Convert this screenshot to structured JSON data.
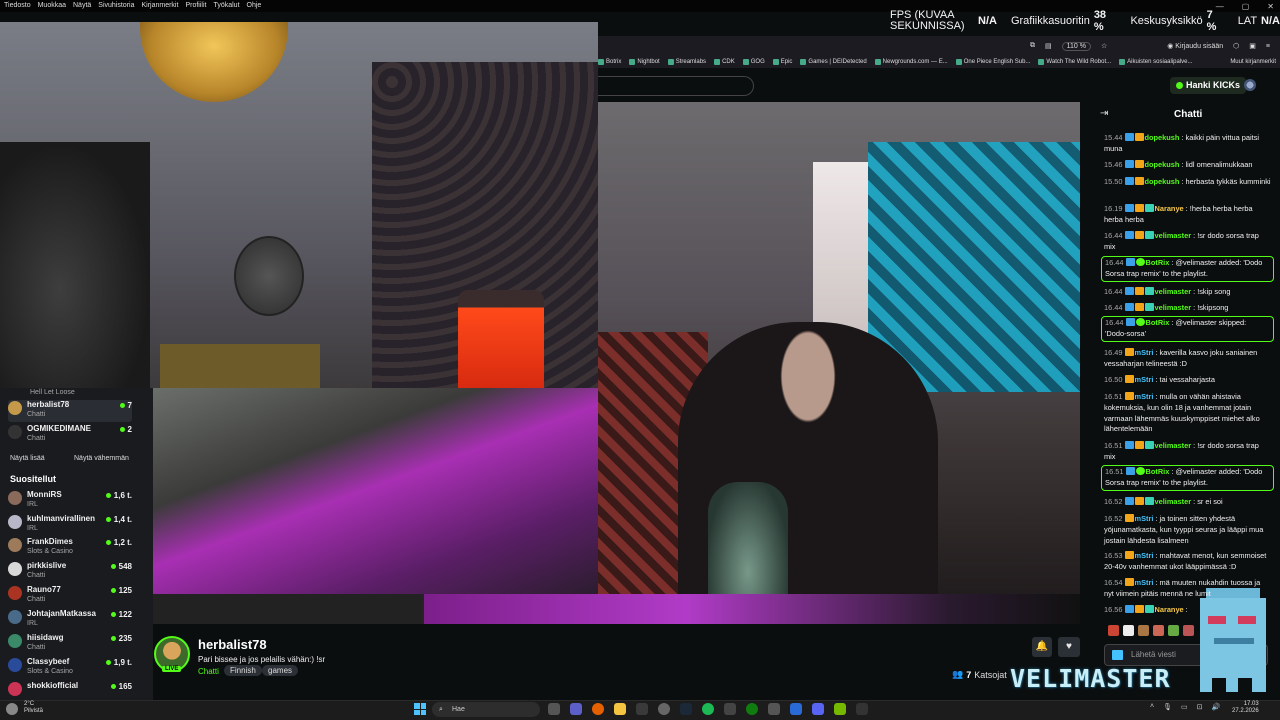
{
  "browser_menu": [
    "Tiedosto",
    "Muokkaa",
    "Näytä",
    "Sivuhistoria",
    "Kirjanmerkit",
    "Profiilit",
    "Työkalut",
    "Ohje"
  ],
  "perf_overlay": {
    "fps_label": "FPS (KUVAA SEKUNNISSA)",
    "fps_value": "N/A",
    "gpu_label": "Grafiikkasuoritin",
    "gpu_value": "38 %",
    "cpu_label": "Keskusyksikkö",
    "cpu_value": "7 %",
    "lat_label": "LAT",
    "lat_value": "N/A"
  },
  "navbar": {
    "zoom": "110 %",
    "signin": "Kirjaudu sisään"
  },
  "bookmarks": [
    "Botrix",
    "Nightbot",
    "Streamlabs",
    "CDK",
    "GOG",
    "Epic",
    "Games | DEIDetected",
    "Newgrounds.com — E...",
    "One Piece English Sub...",
    "Watch The Wild Robot...",
    "Aikuisten sosiaalipalve..."
  ],
  "bookmarks_other": "Muut kirjanmerkit",
  "header": {
    "get_kicks": "Hanki KICKs"
  },
  "sidebar": {
    "prev_label": "Hell Let Loose",
    "following": [
      {
        "name": "herbalist78",
        "sub": "Chatti",
        "count": "7",
        "avatar_color": "#c49a4a"
      },
      {
        "name": "OGMIKEDIMANE",
        "sub": "Chatti",
        "count": "2",
        "avatar_color": "#333333"
      }
    ],
    "show_more": "Näytä lisää",
    "show_less": "Näytä vähemmän",
    "recommended_title": "Suositellut",
    "recommended": [
      {
        "name": "MonniRS",
        "sub": "IRL",
        "count": "1,6 t.",
        "avatar_color": "#8a6a5a"
      },
      {
        "name": "kuhlmanvirallinen",
        "sub": "IRL",
        "count": "1,4 t.",
        "avatar_color": "#b7b7c7"
      },
      {
        "name": "FrankDimes",
        "sub": "Slots & Casino",
        "count": "1,2 t.",
        "avatar_color": "#9c7a5a"
      },
      {
        "name": "pirkkislive",
        "sub": "Chatti",
        "count": "548",
        "avatar_color": "#d8d8d8"
      },
      {
        "name": "Rauno77",
        "sub": "Chatti",
        "count": "125",
        "avatar_color": "#aa3322"
      },
      {
        "name": "JohtajanMatkassa",
        "sub": "IRL",
        "count": "122",
        "avatar_color": "#4a6a8a"
      },
      {
        "name": "hiisidawg",
        "sub": "Chatti",
        "count": "235",
        "avatar_color": "#3a8a6a"
      },
      {
        "name": "Classybeef",
        "sub": "Slots & Casino",
        "count": "1,9 t.",
        "avatar_color": "#2a4a9a"
      },
      {
        "name": "shokkiofficial",
        "sub": "",
        "count": "165",
        "avatar_color": "#cc3355"
      }
    ]
  },
  "channel": {
    "name": "herbalist78",
    "live": "LIVE",
    "title": "Pari bissee ja jos pelailis vähän:) !sr",
    "category": "Chatti",
    "tags": [
      "Finnish",
      "games"
    ],
    "viewers_count": "7",
    "viewers_label": "Katsojat",
    "brand": "VELIMASTER"
  },
  "chat": {
    "title": "Chatti",
    "input_placeholder": "Lähetä viesti",
    "messages": [
      {
        "ts": "15.44",
        "user": "dopekush",
        "color": "u-green",
        "text": "kaikki päin vittua paitsi muna",
        "badges": [
          "b1",
          "b2"
        ],
        "bot": false
      },
      {
        "ts": "15.46",
        "user": "dopekush",
        "color": "u-green",
        "text": "lidl omenalimukkaan",
        "badges": [
          "b1",
          "b2"
        ],
        "bot": false
      },
      {
        "ts": "15.50",
        "user": "dopekush",
        "color": "u-green",
        "text": "herbasta tykkäs kumminki",
        "badges": [
          "b1",
          "b2"
        ],
        "bot": false
      },
      {
        "ts": "16.19",
        "user": "Naranye",
        "color": "u-orange",
        "text": "!herba herba herba herba herba",
        "badges": [
          "b1",
          "b2",
          "b3"
        ],
        "bot": false
      },
      {
        "ts": "16.44",
        "user": "velimaster",
        "color": "u-green",
        "text": "!sr dodo sorsa trap mix",
        "badges": [
          "b1",
          "b2",
          "b3"
        ],
        "bot": false
      },
      {
        "ts": "16.44",
        "user": "BotRix",
        "color": "u-green",
        "text": "@velimaster added: 'Dodo Sorsa trap remix' to the playlist.",
        "badges": [
          "b1",
          "b4"
        ],
        "bot": true
      },
      {
        "ts": "16.44",
        "user": "velimaster",
        "color": "u-green",
        "text": "!skip song",
        "badges": [
          "b1",
          "b2",
          "b3"
        ],
        "bot": false
      },
      {
        "ts": "16.44",
        "user": "velimaster",
        "color": "u-green",
        "text": "!skipsong",
        "badges": [
          "b1",
          "b2",
          "b3"
        ],
        "bot": false
      },
      {
        "ts": "16.44",
        "user": "BotRix",
        "color": "u-green",
        "text": "@velimaster skipped: 'Dodo-sorsa'",
        "badges": [
          "b1",
          "b4"
        ],
        "bot": true
      },
      {
        "ts": "16.49",
        "user": "mStri",
        "color": "u-blue",
        "text": "kaverilla kasvo joku saniainen vessaharjan telineestä :D",
        "badges": [
          "b2"
        ],
        "bot": false
      },
      {
        "ts": "16.50",
        "user": "mStri",
        "color": "u-blue",
        "text": "tai vessaharjasta",
        "badges": [
          "b2"
        ],
        "bot": false
      },
      {
        "ts": "16.51",
        "user": "mStri",
        "color": "u-blue",
        "text": "mulla on vähän ahistavia kokemuksia, kun olin 18 ja vanhemmat jotain varmaan lähemmäs kuuskymppiset miehet alko lähentelemään",
        "badges": [
          "b2"
        ],
        "bot": false
      },
      {
        "ts": "16.51",
        "user": "velimaster",
        "color": "u-green",
        "text": "!sr dodo sorsa trap mix",
        "badges": [
          "b1",
          "b2",
          "b3"
        ],
        "bot": false
      },
      {
        "ts": "16.51",
        "user": "BotRix",
        "color": "u-green",
        "text": "@velimaster added: 'Dodo Sorsa trap remix' to the playlist.",
        "badges": [
          "b1",
          "b4"
        ],
        "bot": true
      },
      {
        "ts": "16.52",
        "user": "velimaster",
        "color": "u-green",
        "text": "sr ei soi",
        "badges": [
          "b1",
          "b2",
          "b3"
        ],
        "bot": false
      },
      {
        "ts": "16.52",
        "user": "mStri",
        "color": "u-blue",
        "text": "ja toinen sitten yhdestä yöjunamatkasta, kun tyyppi seuras ja lääppi mua jostain lähdesta lisalmeen",
        "badges": [
          "b2"
        ],
        "bot": false
      },
      {
        "ts": "16.53",
        "user": "mStri",
        "color": "u-blue",
        "text": "mahtavat menot, kun semmoiset 20-40v vanhemmat ukot lääppimässä :D",
        "badges": [
          "b2"
        ],
        "bot": false
      },
      {
        "ts": "16.54",
        "user": "mStri",
        "color": "u-blue",
        "text": "mä muuten nukahdin tuossa ja nyt viimein pitäis mennä ne lumit",
        "badges": [
          "b2"
        ],
        "bot": false
      },
      {
        "ts": "16.56",
        "user": "Naranye",
        "color": "u-orange",
        "text": "",
        "badges": [
          "b1",
          "b2",
          "b3"
        ],
        "bot": false
      }
    ]
  },
  "taskbar": {
    "weather_temp": "2°C",
    "weather_desc": "Pilvistä",
    "search": "Hae",
    "time": "17.03",
    "date": "27.2.2026"
  }
}
